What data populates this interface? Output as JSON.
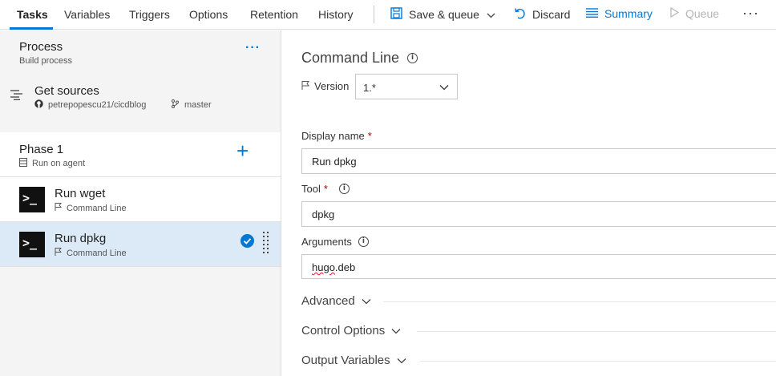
{
  "toolbar": {
    "tabs": [
      "Tasks",
      "Variables",
      "Triggers",
      "Options",
      "Retention",
      "History"
    ],
    "save_queue_label": "Save & queue",
    "discard_label": "Discard",
    "summary_label": "Summary",
    "queue_label": "Queue",
    "more_label": "···"
  },
  "process": {
    "title": "Process",
    "subtitle": "Build process",
    "more_label": "···"
  },
  "get_sources": {
    "title": "Get sources",
    "repo": "petrepopescu21/cicdblog",
    "branch": "master"
  },
  "phase": {
    "title": "Phase 1",
    "subtitle": "Run on agent",
    "add_label": "+"
  },
  "tasks": [
    {
      "title": "Run wget",
      "subtitle": "Command Line",
      "icon_text": ">_"
    },
    {
      "title": "Run dpkg",
      "subtitle": "Command Line",
      "icon_text": ">_"
    }
  ],
  "details": {
    "title": "Command Line",
    "version_label": "Version",
    "version_value": "1.*",
    "display_name_label": "Display name",
    "display_name_value": "Run dpkg",
    "tool_label": "Tool",
    "tool_value": "dpkg",
    "arguments_label": "Arguments",
    "arguments_value_misspelled": "hugo",
    "arguments_value_rest": ".deb",
    "required_mark": "*",
    "info_glyph": "i"
  },
  "sections": [
    "Advanced",
    "Control Options",
    "Output Variables"
  ],
  "colors": {
    "accent": "#0078d4",
    "selected_row": "#dce9f6",
    "left_pane": "#f4f4f4",
    "required": "#a80000",
    "disabled": "#b5b5b5"
  }
}
